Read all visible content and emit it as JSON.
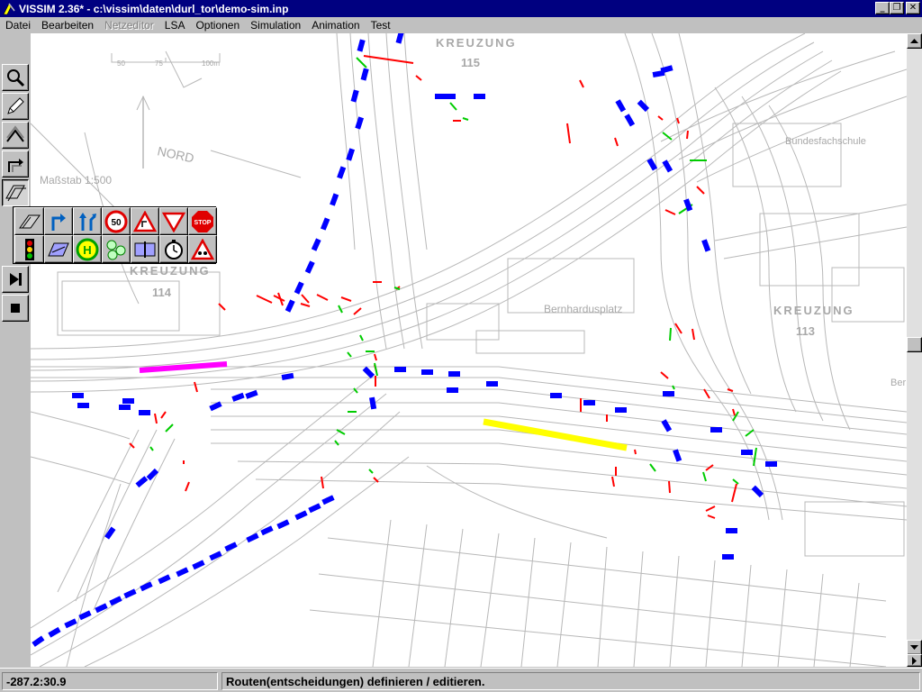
{
  "window": {
    "title": "VISSIM 2.36* - c:\\vissim\\daten\\durl_tor\\demo-sim.inp",
    "minimize_label": "_",
    "maximize_label": "❐",
    "close_label": "✕"
  },
  "menu": {
    "items": [
      {
        "label": "Datei",
        "enabled": true
      },
      {
        "label": "Bearbeiten",
        "enabled": true
      },
      {
        "label": "Netzeditor",
        "enabled": false
      },
      {
        "label": "LSA",
        "enabled": true
      },
      {
        "label": "Optionen",
        "enabled": true
      },
      {
        "label": "Simulation",
        "enabled": true
      },
      {
        "label": "Animation",
        "enabled": true
      },
      {
        "label": "Test",
        "enabled": true
      }
    ]
  },
  "toolbar": {
    "tools": [
      "zoom-icon",
      "pencil-icon",
      "link-icon",
      "connector-icon",
      "route-icon",
      "step-forward-icon",
      "stop-icon"
    ]
  },
  "palette": {
    "signs": {
      "speed_limit": "50",
      "stop": "STOP",
      "bus_stop": "H"
    }
  },
  "map": {
    "labels": {
      "kreuzung_115": "KREUZUNG",
      "num_115": "115",
      "kreuzung_114": "KREUZUNG",
      "num_114": "114",
      "kreuzung_113": "KREUZUNG",
      "num_113": "113",
      "nord": "NORD",
      "massstab": "Maßstab 1:500",
      "bernhardusplatz": "Bernhardusplatz",
      "bundesfachschule": "Bundesfachschule",
      "berth": "Ber",
      "scale_50": "50",
      "scale_75": "75",
      "scale_100m": "100m"
    },
    "colors": {
      "vehicle": "#0000ff",
      "signal_red": "#ff0000",
      "signal_green": "#00cc00",
      "route_magenta": "#ff00ff",
      "route_yellow": "#ffff00",
      "network": "#b8b8b8"
    }
  },
  "status": {
    "coordinates": "-287.2:30.9",
    "message": "Routen(entscheidungen) definieren / editieren."
  }
}
